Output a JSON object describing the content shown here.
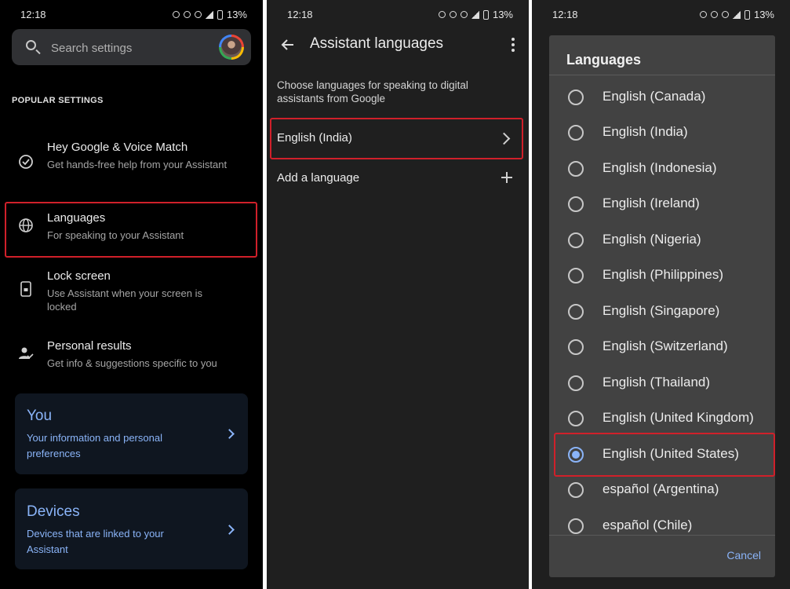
{
  "panel1": {
    "status": {
      "time": "12:18",
      "battery": "13%"
    },
    "search": {
      "placeholder": "Search settings"
    },
    "section_header": "POPULAR SETTINGS",
    "items": [
      {
        "title": "Hey Google & Voice Match",
        "subtitle": "Get hands-free help from your Assistant",
        "icon": "check-circle-icon"
      },
      {
        "title": "Languages",
        "subtitle": "For speaking to your Assistant",
        "icon": "globe-icon"
      },
      {
        "title": "Lock screen",
        "subtitle": "Use Assistant when your screen is locked",
        "icon": "phone-lock-icon"
      },
      {
        "title": "Personal results",
        "subtitle": "Get info & suggestions specific to you",
        "icon": "person-check-icon"
      }
    ],
    "cards": [
      {
        "title": "You",
        "subtitle": "Your information and personal preferences"
      },
      {
        "title": "Devices",
        "subtitle": "Devices that are linked to your Assistant"
      }
    ]
  },
  "panel2": {
    "status": {
      "time": "12:18",
      "battery": "13%"
    },
    "title": "Assistant languages",
    "description": "Choose languages for speaking to digital assistants from Google",
    "current_language": "English (India)",
    "add_language": "Add a language"
  },
  "panel3": {
    "status": {
      "time": "12:18",
      "battery": "13%"
    },
    "dialog_title": "Languages",
    "options": [
      {
        "label": "English (Canada)",
        "selected": false
      },
      {
        "label": "English (India)",
        "selected": false
      },
      {
        "label": "English (Indonesia)",
        "selected": false
      },
      {
        "label": "English (Ireland)",
        "selected": false
      },
      {
        "label": "English (Nigeria)",
        "selected": false
      },
      {
        "label": "English (Philippines)",
        "selected": false
      },
      {
        "label": "English (Singapore)",
        "selected": false
      },
      {
        "label": "English (Switzerland)",
        "selected": false
      },
      {
        "label": "English (Thailand)",
        "selected": false
      },
      {
        "label": "English (United Kingdom)",
        "selected": false
      },
      {
        "label": "English (United States)",
        "selected": true
      },
      {
        "label": "español (Argentina)",
        "selected": false
      },
      {
        "label": "español (Chile)",
        "selected": false
      }
    ],
    "cancel_label": "Cancel"
  },
  "colors": {
    "highlight": "#d0202a",
    "accent": "#8ab4f8"
  }
}
